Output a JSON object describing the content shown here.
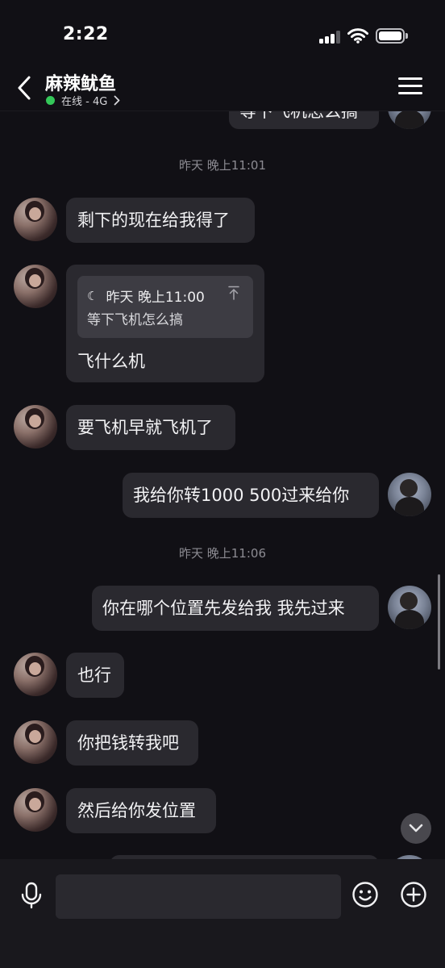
{
  "status_bar": {
    "time": "2:22"
  },
  "header": {
    "contact_name": "麻辣鱿鱼",
    "online_status": "在线 - 4G"
  },
  "messages": {
    "cutoff_text": "等下飞机怎么搞",
    "timestamp_1": "昨天 晚上11:01",
    "msg_1": "剩下的现在给我得了",
    "quote": {
      "time": "昨天 晚上11:00",
      "text": "等下飞机怎么搞"
    },
    "msg_2": "飞什么机",
    "msg_3": "要飞机早就飞机了",
    "msg_4": "我给你转1000 500过来给你",
    "timestamp_2": "昨天 晚上11:06",
    "msg_5": "你在哪个位置先发给我 我先过来",
    "msg_6": "也行",
    "msg_7": "你把钱转我吧",
    "msg_8": "然后给你发位置"
  },
  "input": {
    "placeholder": "",
    "value": ""
  },
  "colors": {
    "background": "#111015",
    "bubble": "#2a292f",
    "online": "#34c759",
    "input_bar": "#19181d"
  },
  "icons": [
    "back-icon",
    "menu-icon",
    "chevron-right-icon",
    "moon-icon",
    "jump-to-top-icon",
    "chevron-down-icon",
    "microphone-icon",
    "emoji-icon",
    "plus-icon"
  ]
}
